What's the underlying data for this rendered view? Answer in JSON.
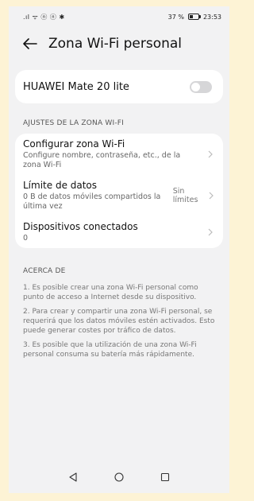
{
  "status_bar": {
    "signal_icons": ".ıl ᯤ ⓝ ⓝ ✱",
    "battery_percent": "37 %",
    "time": "23:53"
  },
  "header": {
    "title": "Zona Wi-Fi personal",
    "back_icon": "arrow-left-icon"
  },
  "hotspot": {
    "device_name": "HUAWEI Mate 20 lite",
    "enabled": false
  },
  "settings_section": {
    "title": "AJUSTES DE LA ZONA WI-FI",
    "items": [
      {
        "title": "Configurar zona Wi-Fi",
        "subtitle": "Configure nombre, contraseña, etc., de la zona Wi-Fi",
        "value": ""
      },
      {
        "title": "Límite de datos",
        "subtitle": "0 B de datos móviles compartidos la última vez",
        "value": "Sin límites"
      },
      {
        "title": "Dispositivos conectados",
        "subtitle": "0",
        "value": ""
      }
    ]
  },
  "about_section": {
    "title": "ACERCA DE",
    "paragraphs": [
      "1. Es posible crear una zona Wi-Fi personal como punto de acceso a Internet desde su dispositivo.",
      "2. Para crear y compartir una zona Wi-Fi personal, se requerirá que los datos móviles estén activados. Esto puede generar costes por tráfico de datos.",
      "3. Es posible que la utilización de una zona Wi-Fi personal consuma su batería más rápidamente."
    ]
  },
  "nav_bar": {
    "buttons": [
      "back-triangle-icon",
      "home-circle-icon",
      "recents-square-icon"
    ]
  }
}
